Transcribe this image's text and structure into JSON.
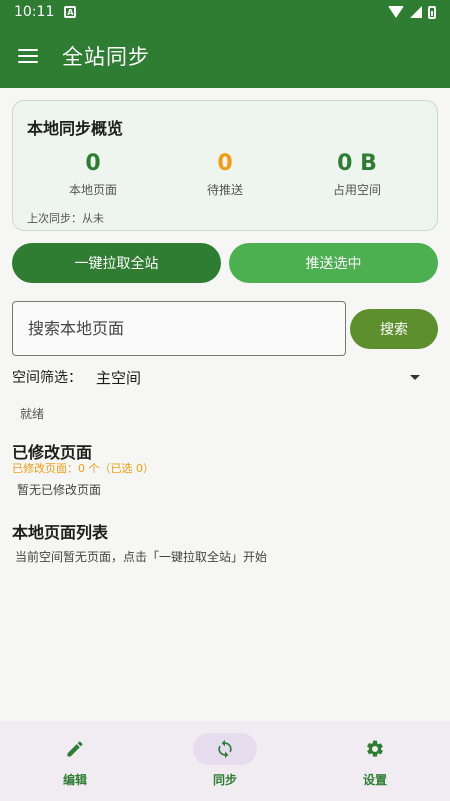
{
  "status_bar": {
    "time": "10:11",
    "notif": "A"
  },
  "app_bar": {
    "title": "全站同步"
  },
  "overview": {
    "title": "本地同步概览",
    "stats": [
      {
        "value": "0",
        "label": "本地页面"
      },
      {
        "value": "0",
        "label": "待推送"
      },
      {
        "value": "0 B",
        "label": "占用空间"
      }
    ],
    "last_sync": "上次同步：从未"
  },
  "actions": {
    "pull_label": "一键拉取全站",
    "push_label": "推送选中"
  },
  "search": {
    "placeholder": "搜索本地页面",
    "button_label": "搜索"
  },
  "space_filter": {
    "label": "空间筛选：",
    "value": "主空间"
  },
  "status_text": "就绪",
  "modified": {
    "title": "已修改页面",
    "count_text": "已修改页面：0 个（已选 0）",
    "empty_text": "暂无已修改页面"
  },
  "page_list": {
    "title": "本地页面列表",
    "empty_text": "当前空间暂无页面，点击「一键拉取全站」开始"
  },
  "bottom_nav": {
    "items": [
      {
        "label": "编辑",
        "icon": "pencil-icon"
      },
      {
        "label": "同步",
        "icon": "sync-icon"
      },
      {
        "label": "设置",
        "icon": "gear-icon"
      }
    ]
  },
  "colors": {
    "primary": "#2e7d32",
    "accent_orange": "#f39c12",
    "push_green": "#4caf50"
  }
}
